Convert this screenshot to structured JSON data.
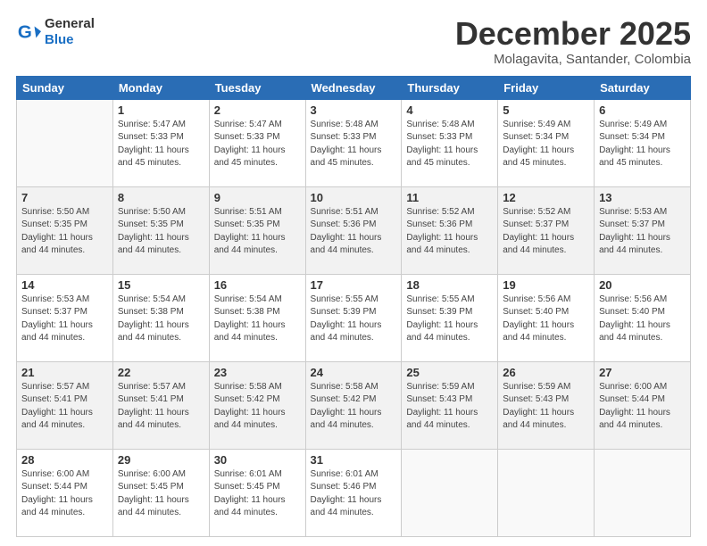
{
  "header": {
    "logo_line1": "General",
    "logo_line2": "Blue",
    "month_title": "December 2025",
    "location": "Molagavita, Santander, Colombia"
  },
  "days_of_week": [
    "Sunday",
    "Monday",
    "Tuesday",
    "Wednesday",
    "Thursday",
    "Friday",
    "Saturday"
  ],
  "weeks": [
    [
      {
        "num": "",
        "info": ""
      },
      {
        "num": "1",
        "info": "Sunrise: 5:47 AM\nSunset: 5:33 PM\nDaylight: 11 hours\nand 45 minutes."
      },
      {
        "num": "2",
        "info": "Sunrise: 5:47 AM\nSunset: 5:33 PM\nDaylight: 11 hours\nand 45 minutes."
      },
      {
        "num": "3",
        "info": "Sunrise: 5:48 AM\nSunset: 5:33 PM\nDaylight: 11 hours\nand 45 minutes."
      },
      {
        "num": "4",
        "info": "Sunrise: 5:48 AM\nSunset: 5:33 PM\nDaylight: 11 hours\nand 45 minutes."
      },
      {
        "num": "5",
        "info": "Sunrise: 5:49 AM\nSunset: 5:34 PM\nDaylight: 11 hours\nand 45 minutes."
      },
      {
        "num": "6",
        "info": "Sunrise: 5:49 AM\nSunset: 5:34 PM\nDaylight: 11 hours\nand 45 minutes."
      }
    ],
    [
      {
        "num": "7",
        "info": "Sunrise: 5:50 AM\nSunset: 5:35 PM\nDaylight: 11 hours\nand 44 minutes."
      },
      {
        "num": "8",
        "info": "Sunrise: 5:50 AM\nSunset: 5:35 PM\nDaylight: 11 hours\nand 44 minutes."
      },
      {
        "num": "9",
        "info": "Sunrise: 5:51 AM\nSunset: 5:35 PM\nDaylight: 11 hours\nand 44 minutes."
      },
      {
        "num": "10",
        "info": "Sunrise: 5:51 AM\nSunset: 5:36 PM\nDaylight: 11 hours\nand 44 minutes."
      },
      {
        "num": "11",
        "info": "Sunrise: 5:52 AM\nSunset: 5:36 PM\nDaylight: 11 hours\nand 44 minutes."
      },
      {
        "num": "12",
        "info": "Sunrise: 5:52 AM\nSunset: 5:37 PM\nDaylight: 11 hours\nand 44 minutes."
      },
      {
        "num": "13",
        "info": "Sunrise: 5:53 AM\nSunset: 5:37 PM\nDaylight: 11 hours\nand 44 minutes."
      }
    ],
    [
      {
        "num": "14",
        "info": "Sunrise: 5:53 AM\nSunset: 5:37 PM\nDaylight: 11 hours\nand 44 minutes."
      },
      {
        "num": "15",
        "info": "Sunrise: 5:54 AM\nSunset: 5:38 PM\nDaylight: 11 hours\nand 44 minutes."
      },
      {
        "num": "16",
        "info": "Sunrise: 5:54 AM\nSunset: 5:38 PM\nDaylight: 11 hours\nand 44 minutes."
      },
      {
        "num": "17",
        "info": "Sunrise: 5:55 AM\nSunset: 5:39 PM\nDaylight: 11 hours\nand 44 minutes."
      },
      {
        "num": "18",
        "info": "Sunrise: 5:55 AM\nSunset: 5:39 PM\nDaylight: 11 hours\nand 44 minutes."
      },
      {
        "num": "19",
        "info": "Sunrise: 5:56 AM\nSunset: 5:40 PM\nDaylight: 11 hours\nand 44 minutes."
      },
      {
        "num": "20",
        "info": "Sunrise: 5:56 AM\nSunset: 5:40 PM\nDaylight: 11 hours\nand 44 minutes."
      }
    ],
    [
      {
        "num": "21",
        "info": "Sunrise: 5:57 AM\nSunset: 5:41 PM\nDaylight: 11 hours\nand 44 minutes."
      },
      {
        "num": "22",
        "info": "Sunrise: 5:57 AM\nSunset: 5:41 PM\nDaylight: 11 hours\nand 44 minutes."
      },
      {
        "num": "23",
        "info": "Sunrise: 5:58 AM\nSunset: 5:42 PM\nDaylight: 11 hours\nand 44 minutes."
      },
      {
        "num": "24",
        "info": "Sunrise: 5:58 AM\nSunset: 5:42 PM\nDaylight: 11 hours\nand 44 minutes."
      },
      {
        "num": "25",
        "info": "Sunrise: 5:59 AM\nSunset: 5:43 PM\nDaylight: 11 hours\nand 44 minutes."
      },
      {
        "num": "26",
        "info": "Sunrise: 5:59 AM\nSunset: 5:43 PM\nDaylight: 11 hours\nand 44 minutes."
      },
      {
        "num": "27",
        "info": "Sunrise: 6:00 AM\nSunset: 5:44 PM\nDaylight: 11 hours\nand 44 minutes."
      }
    ],
    [
      {
        "num": "28",
        "info": "Sunrise: 6:00 AM\nSunset: 5:44 PM\nDaylight: 11 hours\nand 44 minutes."
      },
      {
        "num": "29",
        "info": "Sunrise: 6:00 AM\nSunset: 5:45 PM\nDaylight: 11 hours\nand 44 minutes."
      },
      {
        "num": "30",
        "info": "Sunrise: 6:01 AM\nSunset: 5:45 PM\nDaylight: 11 hours\nand 44 minutes."
      },
      {
        "num": "31",
        "info": "Sunrise: 6:01 AM\nSunset: 5:46 PM\nDaylight: 11 hours\nand 44 minutes."
      },
      {
        "num": "",
        "info": ""
      },
      {
        "num": "",
        "info": ""
      },
      {
        "num": "",
        "info": ""
      }
    ]
  ]
}
